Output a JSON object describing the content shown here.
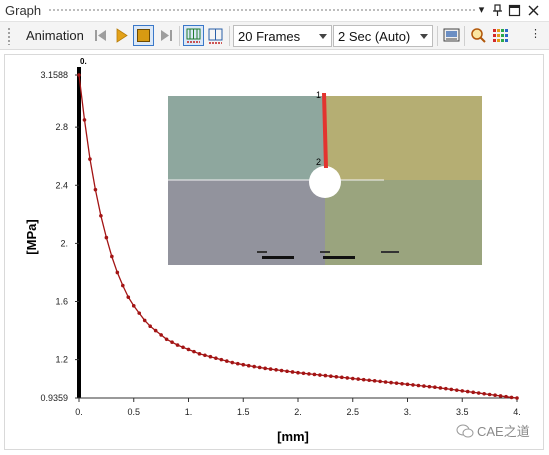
{
  "window": {
    "title": "Graph",
    "icons": [
      "dropdown-arrow-icon",
      "pin-icon",
      "maximize-icon",
      "close-icon"
    ]
  },
  "toolbar": {
    "animation_label": "Animation",
    "frames_value": "20 Frames",
    "duration_value": "2 Sec (Auto)",
    "buttons": [
      "previous-icon",
      "play-icon",
      "stop-icon",
      "next-icon",
      "distributed-icon",
      "split-icon",
      "export-icon",
      "zoom-icon",
      "legend-icon"
    ]
  },
  "colors": {
    "accent": "#3a78c9",
    "curve": "#a31414",
    "axis": "#000000",
    "play": "#e3a21a",
    "stop": "#d79a12"
  },
  "chart_data": {
    "type": "line",
    "xlabel": "[mm]",
    "ylabel": "[MPa]",
    "xlim": [
      0,
      4.0
    ],
    "ylim": [
      0.9359,
      3.1588
    ],
    "x_ticks": [
      "0.",
      "0.5",
      "1.",
      "1.5",
      "2.",
      "2.5",
      "3.",
      "3.5",
      "4."
    ],
    "y_ticks": [
      "3.1588",
      "2.8",
      "2.4",
      "2.",
      "1.6",
      "1.2",
      "0.9359"
    ],
    "y_tick_values": [
      3.1588,
      2.8,
      2.4,
      2.0,
      1.6,
      1.2,
      0.9359
    ],
    "cursor_label": "0.",
    "series": [
      {
        "x": [
          0.0,
          0.05,
          0.1,
          0.15,
          0.2,
          0.25,
          0.3,
          0.35,
          0.4,
          0.45,
          0.5,
          0.55,
          0.6,
          0.65,
          0.7,
          0.75,
          0.8,
          0.85,
          0.9,
          0.95,
          1.0,
          1.05,
          1.1,
          1.15,
          1.2,
          1.25,
          1.3,
          1.35,
          1.4,
          1.45,
          1.5,
          1.55,
          1.6,
          1.65,
          1.7,
          1.75,
          1.8,
          1.85,
          1.9,
          1.95,
          2.0,
          2.05,
          2.1,
          2.15,
          2.2,
          2.25,
          2.3,
          2.35,
          2.4,
          2.45,
          2.5,
          2.55,
          2.6,
          2.65,
          2.7,
          2.75,
          2.8,
          2.85,
          2.9,
          2.95,
          3.0,
          3.05,
          3.1,
          3.15,
          3.2,
          3.25,
          3.3,
          3.35,
          3.4,
          3.45,
          3.5,
          3.55,
          3.6,
          3.65,
          3.7,
          3.75,
          3.8,
          3.85,
          3.9,
          3.95,
          4.0
        ],
        "values": [
          3.1588,
          2.85,
          2.58,
          2.37,
          2.19,
          2.04,
          1.91,
          1.8,
          1.71,
          1.63,
          1.57,
          1.52,
          1.47,
          1.43,
          1.4,
          1.37,
          1.34,
          1.32,
          1.3,
          1.285,
          1.27,
          1.255,
          1.24,
          1.23,
          1.22,
          1.21,
          1.2,
          1.19,
          1.18,
          1.172,
          1.165,
          1.158,
          1.152,
          1.146,
          1.14,
          1.135,
          1.13,
          1.125,
          1.12,
          1.115,
          1.11,
          1.106,
          1.102,
          1.098,
          1.094,
          1.09,
          1.086,
          1.082,
          1.078,
          1.074,
          1.07,
          1.066,
          1.062,
          1.058,
          1.054,
          1.05,
          1.046,
          1.042,
          1.038,
          1.034,
          1.03,
          1.026,
          1.022,
          1.018,
          1.014,
          1.01,
          1.005,
          1.0,
          0.995,
          0.99,
          0.985,
          0.98,
          0.975,
          0.97,
          0.965,
          0.96,
          0.955,
          0.95,
          0.945,
          0.94,
          0.9359
        ]
      }
    ],
    "grid": false,
    "legend": "none"
  },
  "inset": {
    "quadrant_colors": [
      "#8ea79e",
      "#b5ae73",
      "#92939d",
      "#9aa47e"
    ],
    "marker_labels": [
      "1",
      "2"
    ],
    "path_color": "#e3342f"
  },
  "watermark": {
    "text": "CAE之道"
  }
}
